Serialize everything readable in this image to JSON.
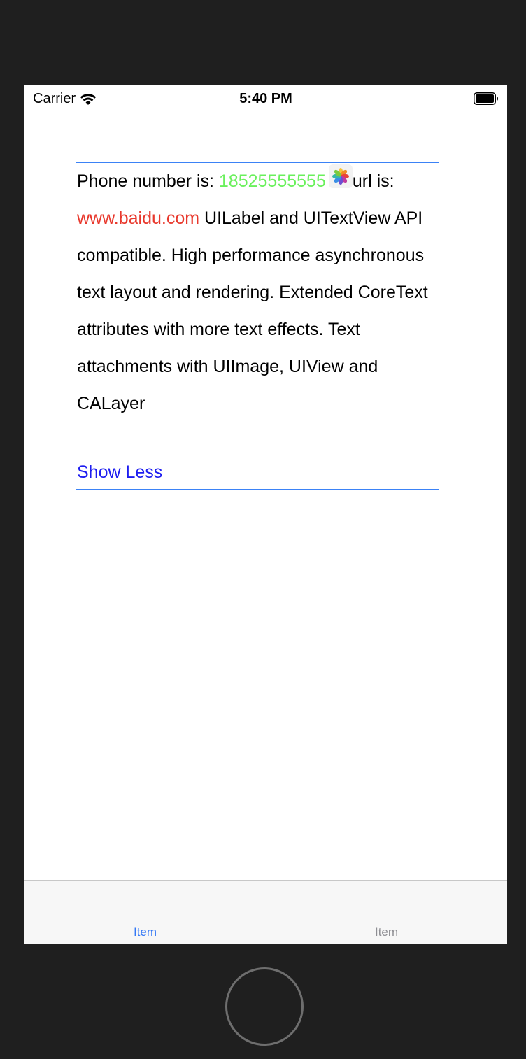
{
  "status_bar": {
    "carrier": "Carrier",
    "time": "5:40 PM",
    "wifi_icon": "wifi-icon",
    "battery_icon": "battery-full-icon"
  },
  "label": {
    "prefix_phone": "Phone number is: ",
    "phone": "18525555555",
    "url_prefix": "url is: ",
    "url": "www.baidu.com",
    "body": " UILabel and UITextView API compatible. High performance asynchronous text layout and rendering. Extended CoreText attributes with more text effects. Text attachments with UIImage, UIView and CALayer",
    "attachment_icon": "photos-icon",
    "show_less": "Show Less",
    "colors": {
      "phone": "#6af05c",
      "url": "#e8382c",
      "show_less": "#1d1df0",
      "border": "#3b82f6"
    }
  },
  "tab_bar": {
    "items": [
      {
        "label": "Item",
        "selected": true,
        "color": "#3478f6"
      },
      {
        "label": "Item",
        "selected": false,
        "color": "#8e8e93"
      }
    ]
  }
}
